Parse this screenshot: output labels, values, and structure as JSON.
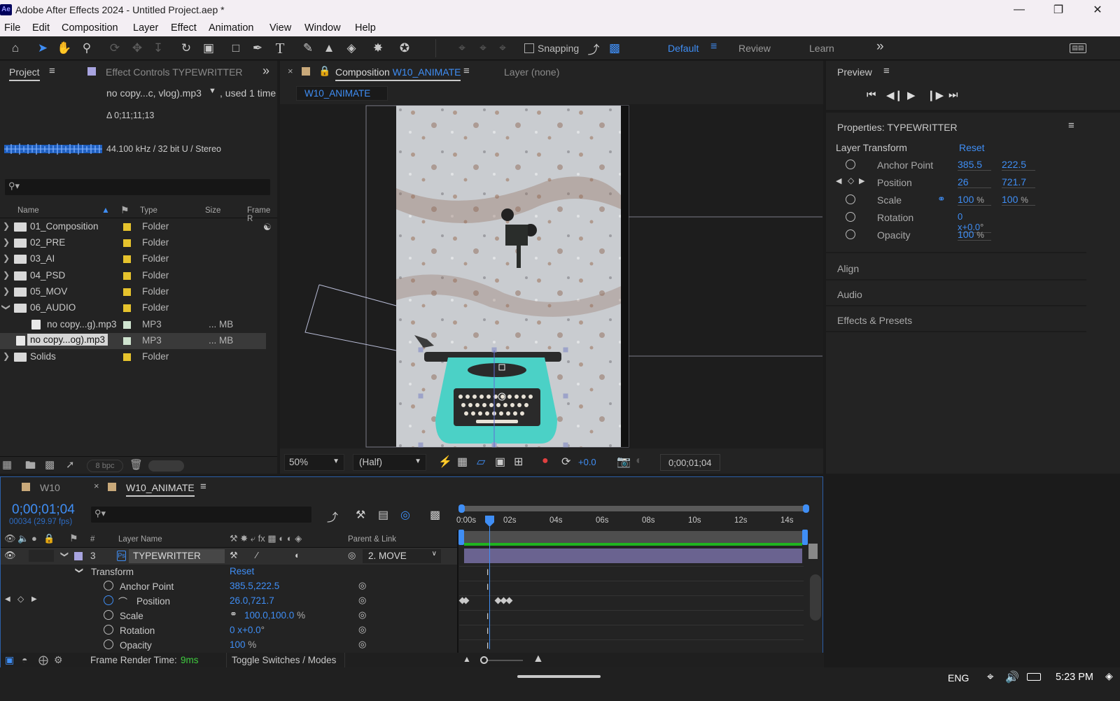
{
  "window": {
    "title": "Adobe After Effects 2024 - Untitled Project.aep *",
    "logo": "Ae"
  },
  "menu": [
    "File",
    "Edit",
    "Composition",
    "Layer",
    "Effect",
    "Animation",
    "View",
    "Window",
    "Help"
  ],
  "toolbar": {
    "snapping_label": "Snapping",
    "workspaces": [
      "Default",
      "Review",
      "Learn"
    ],
    "more": "»"
  },
  "project": {
    "tab": "Project",
    "effect_controls_tab": "Effect Controls TYPEWRITTER",
    "selected_file": "no copy...c, vlog).mp3",
    "used": ", used 1 time",
    "duration": "Δ 0;11;11;13",
    "audio_info": "44.100 kHz / 32 bit U / Stereo",
    "columns": {
      "name": "Name",
      "type": "Type",
      "size": "Size",
      "frame": "Frame R"
    },
    "items": [
      {
        "name": "01_Composition",
        "type": "Folder",
        "size": "",
        "color": "#e6c32d"
      },
      {
        "name": "02_PRE",
        "type": "Folder",
        "size": "",
        "color": "#e6c32d"
      },
      {
        "name": "03_AI",
        "type": "Folder",
        "size": "",
        "color": "#e6c32d"
      },
      {
        "name": "04_PSD",
        "type": "Folder",
        "size": "",
        "color": "#e6c32d"
      },
      {
        "name": "05_MOV",
        "type": "Folder",
        "size": "",
        "color": "#e6c32d"
      },
      {
        "name": "06_AUDIO",
        "type": "Folder",
        "size": "",
        "color": "#e6c32d"
      },
      {
        "name": "no copy...g).mp3",
        "type": "MP3",
        "size": "... MB",
        "color": "#cfe3cf"
      },
      {
        "name": "no copy...og).mp3",
        "type": "MP3",
        "size": "... MB",
        "color": "#cfe3cf"
      },
      {
        "name": "Solids",
        "type": "Folder",
        "size": "",
        "color": "#e6c32d"
      }
    ],
    "bpc": "8 bpc"
  },
  "composition": {
    "tab_prefix": "Composition",
    "name": "W10_ANIMATE",
    "layer_tab": "Layer  (none)",
    "subtab": "W10_ANIMATE",
    "zoom": "50%",
    "resolution": "(Half)",
    "exposure": "+0.0",
    "timecode": "0;00;01;04"
  },
  "preview": {
    "title": "Preview"
  },
  "properties": {
    "title": "Properties: TYPEWRITTER",
    "section": "Layer Transform",
    "reset": "Reset",
    "rows": [
      {
        "label": "Anchor Point",
        "v1": "385.5",
        "v2": "222.5"
      },
      {
        "label": "Position",
        "v1": "26",
        "v2": "721.7"
      },
      {
        "label": "Scale",
        "v1": "100",
        "u1": "%",
        "v2": "100",
        "u2": "%"
      },
      {
        "label": "Rotation",
        "v1": "0 x+0.0",
        "u1": "°"
      },
      {
        "label": "Opacity",
        "v1": "100",
        "u1": "%"
      }
    ],
    "panels": [
      "Align",
      "Audio",
      "Effects & Presets"
    ]
  },
  "timeline": {
    "tabs": [
      "W10",
      "W10_ANIMATE"
    ],
    "timecode": "0;00;01;04",
    "frames": "00034 (29.97 fps)",
    "ruler": [
      "0:00s",
      "02s",
      "04s",
      "06s",
      "08s",
      "10s",
      "12s",
      "14s"
    ],
    "cols": {
      "num": "#",
      "layer": "Layer Name",
      "parent": "Parent & Link"
    },
    "layer": {
      "num": "3",
      "name": "TYPEWRITTER",
      "parent": "2. MOVE"
    },
    "transform": {
      "label": "Transform",
      "reset": "Reset",
      "props": [
        {
          "label": "Anchor Point",
          "value": "385.5,222.5"
        },
        {
          "label": "Position",
          "value": "26.0,721.7"
        },
        {
          "label": "Scale",
          "value": "100.0,100.0",
          "unit": "%"
        },
        {
          "label": "Rotation",
          "value": "0 x+0.0",
          "unit": "°"
        },
        {
          "label": "Opacity",
          "value": "100",
          "unit": "%"
        }
      ]
    },
    "render_label": "Frame Render Time:",
    "render_time": "9ms",
    "toggle": "Toggle Switches / Modes"
  },
  "taskbar": {
    "lang": "ENG",
    "time": "5:23 PM"
  },
  "colors": {
    "accent": "#3f8ef5",
    "bg": "#232323",
    "green_bar": "#1fb31f",
    "layer_bar": "#6a6390"
  }
}
